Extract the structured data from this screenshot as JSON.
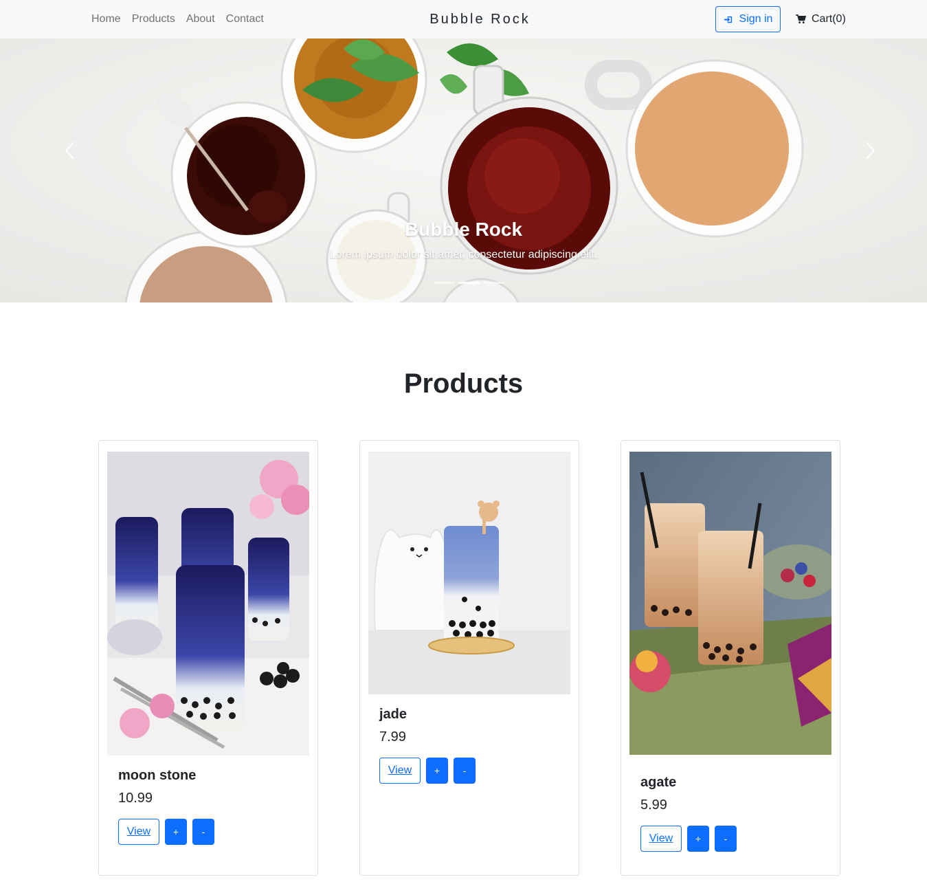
{
  "nav": {
    "links": [
      "Home",
      "Products",
      "About",
      "Contact"
    ],
    "brand": "Bubble Rock",
    "signin_label": "Sign in",
    "cart_label": "Cart(0)",
    "icons": {
      "signin": "sign-in-icon",
      "cart": "shopping-cart-icon"
    }
  },
  "carousel": {
    "title": "Bubble Rock",
    "text": "Lorem ipsum dolor sit amet, consectetur adipiscing elit.",
    "slide_count": 3,
    "active_slide": 2
  },
  "products": {
    "title": "Products",
    "view_label": "View",
    "plus_label": "+",
    "minus_label": "-",
    "items": [
      {
        "name": "moon stone",
        "price": "10.99"
      },
      {
        "name": "jade",
        "price": "7.99"
      },
      {
        "name": "agate",
        "price": "5.99"
      }
    ]
  },
  "colors": {
    "primary": "#0d6efd",
    "navbar_bg": "#f8f9fa",
    "text": "#212529"
  }
}
